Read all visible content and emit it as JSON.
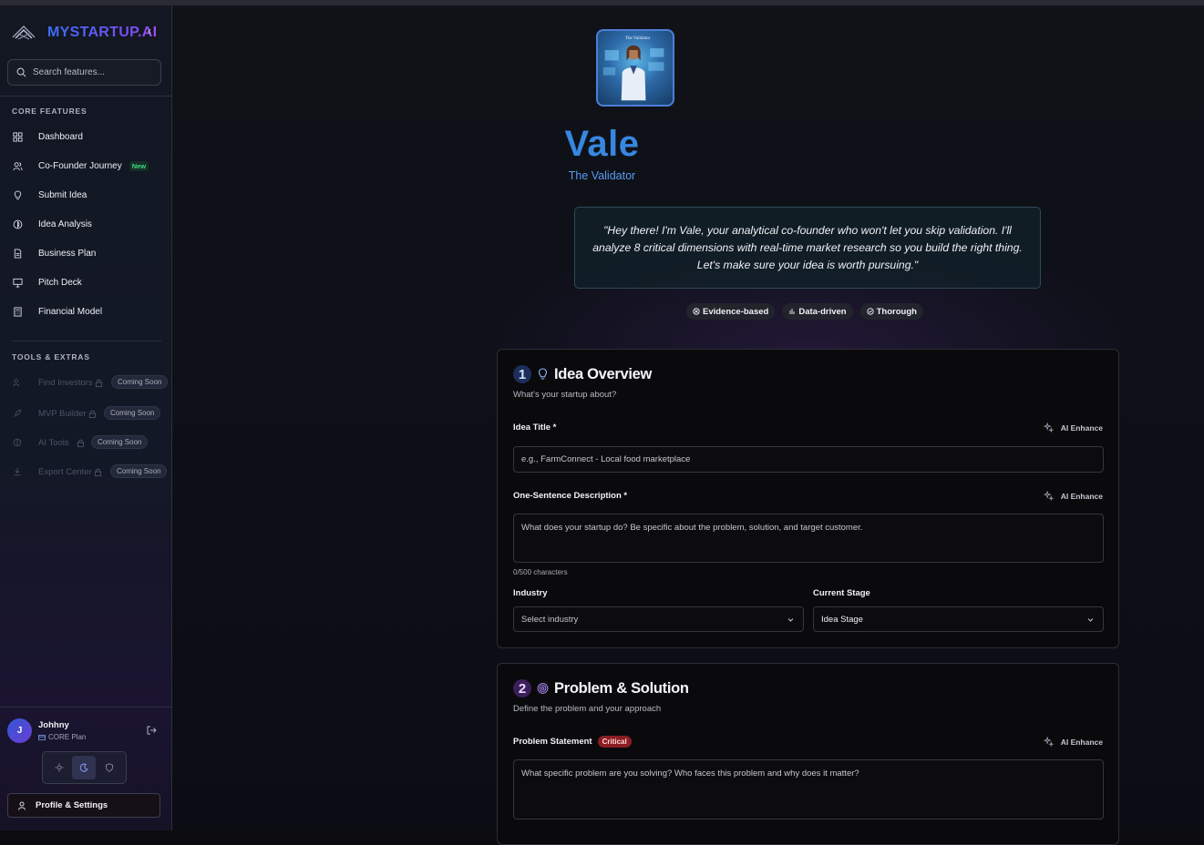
{
  "brand": {
    "name": "MYSTARTUP.AI"
  },
  "search": {
    "placeholder": "Search features..."
  },
  "sidebar": {
    "core_title": "CORE FEATURES",
    "core_items": [
      {
        "label": "Dashboard",
        "icon": "grid-icon"
      },
      {
        "label": "Co-Founder Journey",
        "icon": "users-icon",
        "badge": "New"
      },
      {
        "label": "Submit Idea",
        "icon": "lightbulb-icon"
      },
      {
        "label": "Idea Analysis",
        "icon": "analysis-icon"
      },
      {
        "label": "Business Plan",
        "icon": "document-icon"
      },
      {
        "label": "Pitch Deck",
        "icon": "presentation-icon"
      },
      {
        "label": "Financial Model",
        "icon": "calculator-icon"
      }
    ],
    "tools_title": "TOOLS & EXTRAS",
    "tool_items": [
      {
        "label": "Find Investors",
        "icon": "users-icon",
        "status": "Coming Soon"
      },
      {
        "label": "MVP Builder",
        "icon": "rocket-icon",
        "status": "Coming Soon"
      },
      {
        "label": "AI Tools",
        "icon": "ai-icon",
        "status": "Coming Soon"
      },
      {
        "label": "Export Center",
        "icon": "download-icon",
        "status": "Coming Soon"
      }
    ]
  },
  "user": {
    "initial": "J",
    "name": "Johhny",
    "plan": "CORE Plan"
  },
  "profile": {
    "label": "Profile & Settings"
  },
  "hero": {
    "portrait_caption": "The Validator",
    "name": "Vale",
    "role": "The Validator",
    "quote": "\"Hey there! I'm Vale, your analytical co-founder who won't let you skip validation. I'll analyze 8 critical dimensions with real-time market research so you build the right thing. Let's make sure your idea is worth pursuing.\"",
    "tags": [
      "Evidence-based",
      "Data-driven",
      "Thorough"
    ]
  },
  "section1": {
    "number": "1",
    "title": "Idea Overview",
    "subtitle": "What's your startup about?",
    "idea_title_label": "Idea Title *",
    "idea_title_placeholder": "e.g., FarmConnect - Local food marketplace",
    "description_label": "One-Sentence Description *",
    "description_placeholder": "What does your startup do? Be specific about the problem, solution, and target customer.",
    "counter": "0/500 characters",
    "industry_label": "Industry",
    "industry_value": "Select industry",
    "stage_label": "Current Stage",
    "stage_value": "Idea Stage",
    "enhance_label": "AI Enhance"
  },
  "section2": {
    "number": "2",
    "title": "Problem & Solution",
    "subtitle": "Define the problem and your approach",
    "problem_label": "Problem Statement",
    "problem_badge": "Critical",
    "problem_placeholder": "What specific problem are you solving? Who faces this problem and why does it matter?",
    "enhance_label": "AI Enhance"
  }
}
